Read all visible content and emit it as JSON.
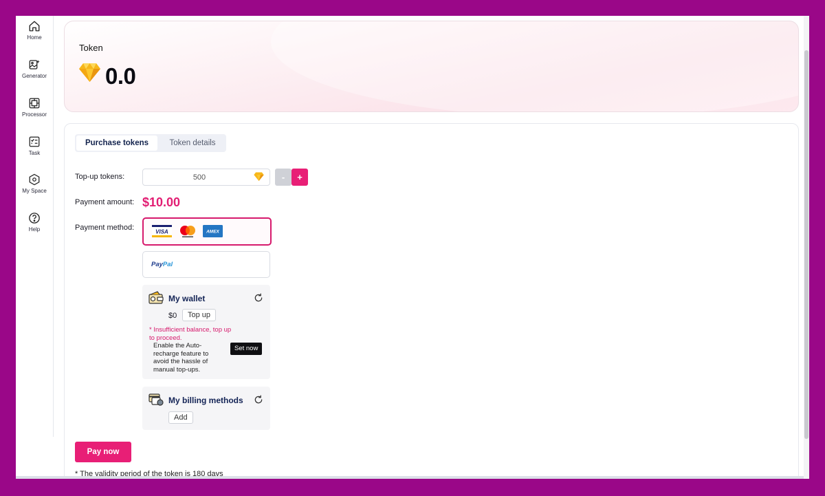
{
  "sidebar": {
    "items": [
      {
        "label": "Home",
        "icon": "home-icon"
      },
      {
        "label": "Generator",
        "icon": "generator-icon"
      },
      {
        "label": "Processor",
        "icon": "processor-icon"
      },
      {
        "label": "Task",
        "icon": "task-icon"
      },
      {
        "label": "My Space",
        "icon": "my-space-icon"
      },
      {
        "label": "Help",
        "icon": "help-icon"
      }
    ]
  },
  "token": {
    "title": "Token",
    "balance": "0.0",
    "icon": "gem-icon"
  },
  "tabs": [
    {
      "label": "Purchase tokens",
      "active": true
    },
    {
      "label": "Token details",
      "active": false
    }
  ],
  "form": {
    "topup_label": "Top-up tokens:",
    "topup_value": "500",
    "minus_label": "-",
    "plus_label": "+",
    "payment_amount_label": "Payment amount:",
    "payment_amount": "$10.00",
    "payment_method_label": "Payment method:"
  },
  "payment_methods": {
    "cards": [
      "VISA",
      "Mastercard",
      "AMEX"
    ],
    "paypal_pay": "Pay",
    "paypal_pal": "Pal"
  },
  "wallet": {
    "title": "My wallet",
    "amount": "$0",
    "top_up_label": "Top up",
    "warning": "* Insufficient balance, top up to proceed.",
    "auto_recharge_text": "Enable the Auto-recharge feature to avoid the hassle of manual top-ups.",
    "set_now_label": "Set now"
  },
  "billing": {
    "title": "My billing methods",
    "add_label": "Add"
  },
  "pay_now_label": "Pay now",
  "validity_note": "* The validity period of the token is 180 days",
  "colors": {
    "accent": "#e81f76",
    "frame": "#9a0788",
    "title_blue": "#142456"
  }
}
